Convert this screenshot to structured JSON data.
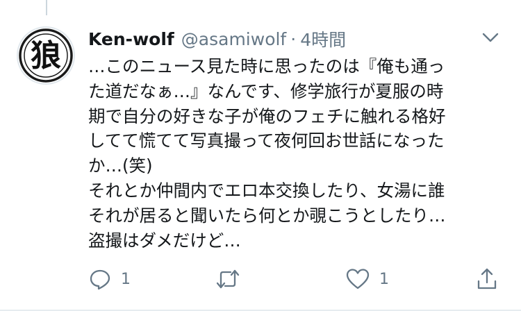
{
  "tweet": {
    "display_name": "Ken-wolf",
    "handle": "@asamiwolf",
    "separator": "·",
    "time": "4時間",
    "avatar_glyph": "狼",
    "text_lines": [
      "…このニュース見た時に思ったのは『俺も通っ",
      "た道だなぁ…』なんです、修学旅行が夏服の時",
      "期で自分の好きな子が俺のフェチに触れる格好",
      "してて慌てて写真撮って夜何回お世話になった",
      "か…(笑)",
      "それとか仲間内でエロ本交換したり、女湯に誰",
      "それが居ると聞いたら何とか覗こうとしたり…",
      "盗撮はダメだけど…"
    ]
  },
  "actions": {
    "reply_count": "1",
    "retweet_count": "",
    "like_count": "1"
  },
  "icons": {
    "caret": "chevron-down-icon",
    "reply": "reply-icon",
    "retweet": "retweet-icon",
    "like": "heart-icon",
    "share": "share-icon"
  },
  "colors": {
    "text": "#14171a",
    "secondary": "#657786",
    "icon": "#657786",
    "divider": "#e6ecf0",
    "thread_line": "#ccd6dd"
  }
}
